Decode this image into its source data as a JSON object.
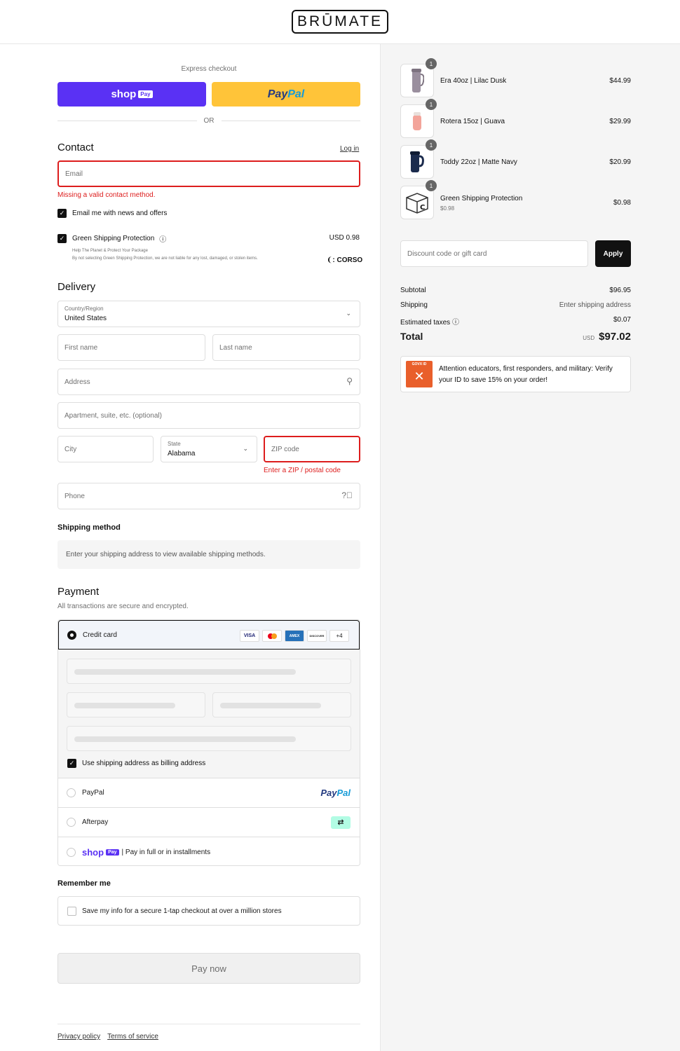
{
  "header": {
    "logo": "BRŪMATE"
  },
  "express": {
    "label": "Express checkout",
    "shop_label": "shop",
    "shop_pay": "Pay",
    "paypal_p1": "Pay",
    "paypal_p2": "Pal",
    "or": "OR"
  },
  "contact": {
    "title": "Contact",
    "login": "Log in",
    "email_placeholder": "Email",
    "email_error": "Missing a valid contact method.",
    "news_label": "Email me with news and offers",
    "green_label": "Green Shipping Protection",
    "green_price": "USD 0.98",
    "green_note1": "Help The Planet & Protect Your Package",
    "green_note2": "By not selecting Green Shipping Protection, we are not liable for any lost, damaged, or stolen items.",
    "corso": "CORSO"
  },
  "delivery": {
    "title": "Delivery",
    "country_label": "Country/Region",
    "country_value": "United States",
    "first_name": "First name",
    "last_name": "Last name",
    "address": "Address",
    "apartment": "Apartment, suite, etc. (optional)",
    "city": "City",
    "state_label": "State",
    "state_value": "Alabama",
    "zip": "ZIP code",
    "zip_error": "Enter a ZIP / postal code",
    "phone": "Phone"
  },
  "shipping": {
    "title": "Shipping method",
    "note": "Enter your shipping address to view available shipping methods."
  },
  "payment": {
    "title": "Payment",
    "subtitle": "All transactions are secure and encrypted.",
    "credit_card": "Credit card",
    "cards": [
      "VISA",
      "MC",
      "AMEX",
      "DISCOVER"
    ],
    "more_cards": "+4",
    "billing_label": "Use shipping address as billing address",
    "paypal": "PayPal",
    "paypal_logo_p1": "Pay",
    "paypal_logo_p2": "Pal",
    "afterpay": "Afterpay",
    "shop_logo": "shop",
    "shop_pay": "Pay",
    "shop_text": "| Pay in full or in installments"
  },
  "remember": {
    "title": "Remember me",
    "label": "Save my info for a secure 1-tap checkout at over a million stores"
  },
  "pay_now": "Pay now",
  "footer": {
    "privacy": "Privacy policy",
    "terms": "Terms of service"
  },
  "order": {
    "items": [
      {
        "name": "Era 40oz | Lilac Dusk",
        "qty": "1",
        "price": "$44.99",
        "sub": ""
      },
      {
        "name": "Rotera 15oz | Guava",
        "qty": "1",
        "price": "$29.99",
        "sub": ""
      },
      {
        "name": "Toddy 22oz | Matte Navy",
        "qty": "1",
        "price": "$20.99",
        "sub": ""
      },
      {
        "name": "Green Shipping Protection",
        "qty": "1",
        "price": "$0.98",
        "sub": "$0.98"
      }
    ],
    "discount_placeholder": "Discount code or gift card",
    "apply": "Apply",
    "subtotal_label": "Subtotal",
    "subtotal": "$96.95",
    "shipping_label": "Shipping",
    "shipping_value": "Enter shipping address",
    "taxes_label": "Estimated taxes",
    "taxes": "$0.07",
    "total_label": "Total",
    "total_currency": "USD",
    "total": "$97.02",
    "promo_badge": "GOVX ID",
    "promo": "Attention educators, first responders, and military: Verify your ID to save 15% on your order!"
  },
  "colors": {
    "shop": "#5a31f4",
    "paypal": "#ffc439",
    "error": "#dd1d1d",
    "govx": "#e95f2b"
  }
}
